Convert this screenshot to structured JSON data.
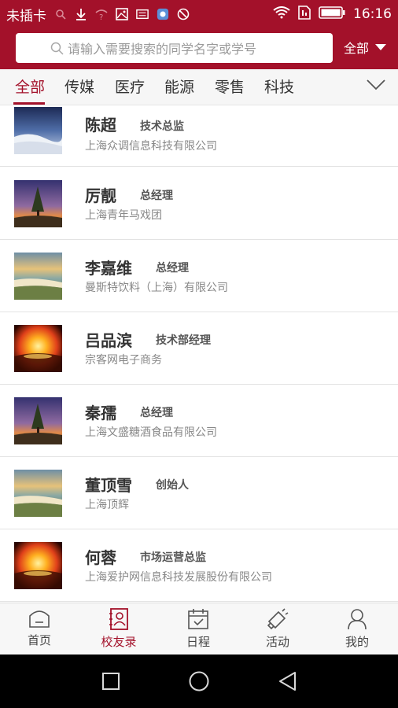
{
  "status_bar": {
    "carrier": "未插卡",
    "time": "16:16",
    "icons": [
      "search-icon",
      "download-icon",
      "wifi-question-icon",
      "image-icon",
      "keyboard-icon",
      "app-icon",
      "no-sign-icon",
      "wifi-icon",
      "sim-icon",
      "battery-icon"
    ]
  },
  "search": {
    "placeholder": "请输入需要搜索的同学名字或学号",
    "filter_label": "全部"
  },
  "tabs": [
    "全部",
    "传媒",
    "医疗",
    "能源",
    "零售",
    "科技"
  ],
  "active_tab": 0,
  "contacts": [
    {
      "name": "陈超",
      "title": "技术总监",
      "company": "上海众调信息科技有限公司",
      "image": "snow-landscape"
    },
    {
      "name": "厉靓",
      "title": "总经理",
      "company": "上海青年马戏团",
      "image": "tree-sunset"
    },
    {
      "name": "李嘉维",
      "title": "总经理",
      "company": "曼斯特饮料（上海）有限公司",
      "image": "coast-cliff"
    },
    {
      "name": "吕品滨",
      "title": "技术部经理",
      "company": "宗客网电子商务",
      "image": "fire-glow"
    },
    {
      "name": "秦孺",
      "title": "总经理",
      "company": "上海文盛糖酒食品有限公司",
      "image": "tree-sunset"
    },
    {
      "name": "董顶雪",
      "title": "创始人",
      "company": "上海顶辉",
      "image": "coast-cliff"
    },
    {
      "name": "何蓉",
      "title": "市场运营总监",
      "company": "上海爱护网信息科技发展股份有限公司",
      "image": "fire-glow"
    }
  ],
  "bottom_nav": [
    {
      "label": "首页",
      "icon": "home-icon"
    },
    {
      "label": "校友录",
      "icon": "contacts-book-icon"
    },
    {
      "label": "日程",
      "icon": "calendar-icon"
    },
    {
      "label": "活动",
      "icon": "megaphone-icon"
    },
    {
      "label": "我的",
      "icon": "user-icon"
    }
  ],
  "active_nav": 1,
  "system_nav": [
    "recent-apps-icon",
    "home-circle-icon",
    "back-icon"
  ],
  "colors": {
    "accent": "#a3112a",
    "text": "#333333",
    "secondary": "#888888"
  }
}
